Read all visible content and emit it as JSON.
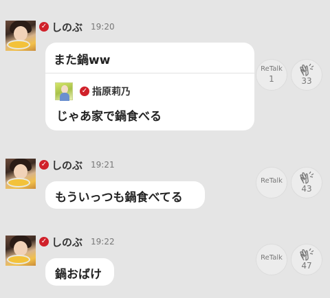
{
  "messages": [
    {
      "user": "しのぶ",
      "time": "19:20",
      "text": "また鍋ww",
      "quote": {
        "user": "指原莉乃",
        "text": "じゃあ家で鍋食べる"
      },
      "retalk_label": "ReTalk",
      "retalk_count": "1",
      "clap_count": "33"
    },
    {
      "user": "しのぶ",
      "time": "19:21",
      "text": "もういっつも鍋食べてる",
      "retalk_label": "ReTalk",
      "clap_count": "43"
    },
    {
      "user": "しのぶ",
      "time": "19:22",
      "text": "鍋おばけ",
      "retalk_label": "ReTalk",
      "clap_count": "47"
    }
  ],
  "icons": {
    "verified": "verified-check-icon",
    "clap": "clap-hands-icon"
  },
  "colors": {
    "verified": "#d0212a",
    "background": "#e5e5e5"
  }
}
